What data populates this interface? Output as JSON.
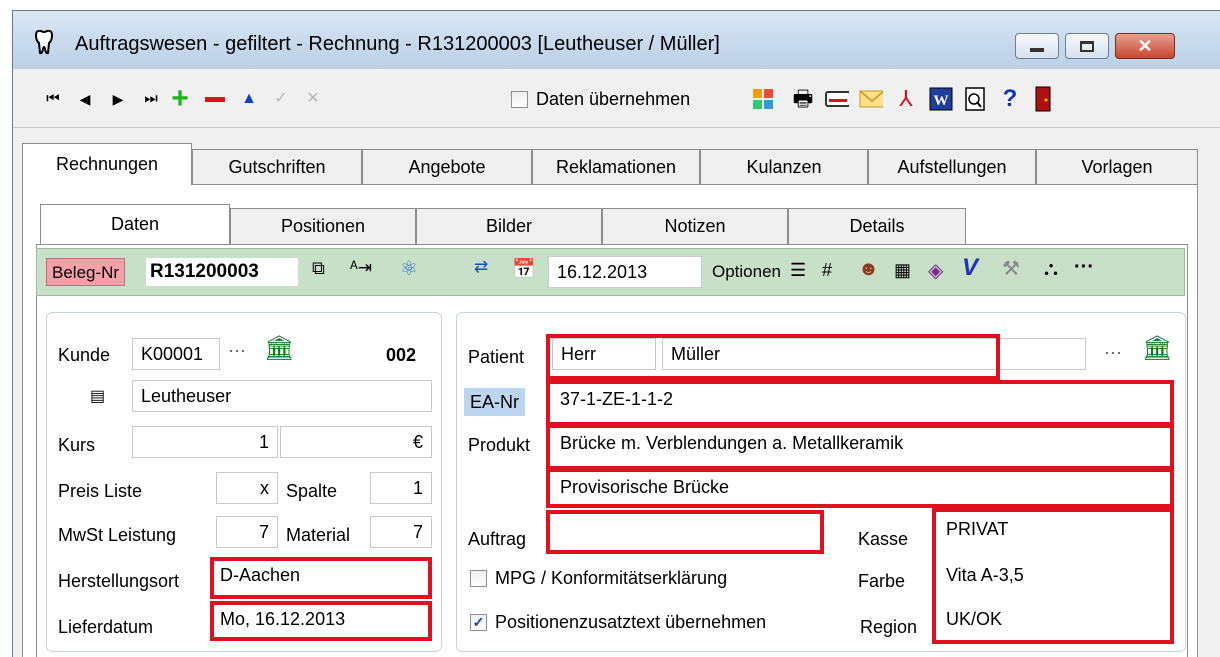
{
  "window": {
    "title": "Auftragswesen - gefiltert - Rechnung - R131200003 [Leutheuser / Müller]",
    "controls": [
      "minimize",
      "maximize",
      "close"
    ]
  },
  "toolbar": {
    "daten_uebernehmen_label": "Daten übernehmen",
    "icons": [
      "first-icon",
      "prev-icon",
      "next-icon",
      "last-icon",
      "add-icon",
      "delete-icon",
      "up-icon",
      "confirm-icon",
      "cancel-icon",
      "apps-icon",
      "print-icon",
      "card-icon",
      "mail-icon",
      "pdf-icon",
      "word-icon",
      "preview-icon",
      "help-icon",
      "exit-icon"
    ]
  },
  "tabs": {
    "main": [
      "Rechnungen",
      "Gutschriften",
      "Angebote",
      "Reklamationen",
      "Kulanzen",
      "Aufstellungen",
      "Vorlagen"
    ],
    "sub": [
      "Daten",
      "Positionen",
      "Bilder",
      "Notizen",
      "Details"
    ]
  },
  "beleg": {
    "label": "Beleg-Nr",
    "number": "R131200003",
    "date": "16.12.2013",
    "optionen": "Optionen"
  },
  "left": {
    "kunde_label": "Kunde",
    "kunde_value": "K00001",
    "kunde_dots": "···",
    "kunde_count": "002",
    "kunde_name": "Leutheuser",
    "kurs_label": "Kurs",
    "kurs_value": "1",
    "kurs_currency": "€",
    "preisliste_label": "Preis Liste",
    "preisliste_value": "x",
    "spalte_label": "Spalte",
    "spalte_value": "1",
    "mwst_label": "MwSt Leistung",
    "mwst_value": "7",
    "material_label": "Material",
    "material_value": "7",
    "herstellungsort_label": "Herstellungsort",
    "herstellungsort_value": "D-Aachen",
    "lieferdatum_label": "Lieferdatum",
    "lieferdatum_value": "Mo, 16.12.2013"
  },
  "right": {
    "patient_label": "Patient",
    "patient_anrede": "Herr",
    "patient_name": "Müller",
    "patient_dots": "···",
    "eanr_label": "EA-Nr",
    "eanr_value": "37-1-ZE-1-1-2",
    "produkt_label": "Produkt",
    "produkt_value1": "Brücke m. Verblendungen a. Metallkeramik",
    "produkt_value2": "Provisorische Brücke",
    "auftrag_label": "Auftrag",
    "auftrag_value": "",
    "kasse_label": "Kasse",
    "kasse_value": "PRIVAT",
    "farbe_label": "Farbe",
    "farbe_value": "Vita A-3,5",
    "region_label": "Region",
    "region_value": "UK/OK",
    "mpg_label": "MPG / Konformitätserklärung",
    "mpg_checked": false,
    "pos_label": "Positionenzusatztext übernehmen",
    "pos_checked": true
  },
  "colors": {
    "highlight": "#e0101e",
    "band": "#c8dfc8",
    "beleg_label_bg": "#f4a0a8",
    "eanr_label_bg": "#bcd6f0"
  }
}
